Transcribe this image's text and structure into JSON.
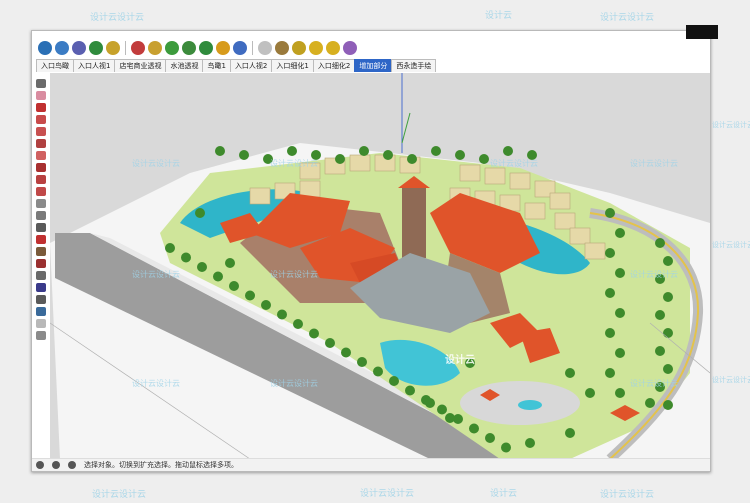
{
  "toolbar": {
    "icons": [
      {
        "name": "globe-icon",
        "color": "#2a6fb5"
      },
      {
        "name": "globe-icon",
        "color": "#3b7cc4"
      },
      {
        "name": "globe-icon",
        "color": "#5a5fb0"
      },
      {
        "name": "globe-icon",
        "color": "#2f8b3c"
      },
      {
        "name": "pencil-icon",
        "color": "#c7a22b"
      },
      {
        "name": "arrow-icon",
        "color": "#c23c3c"
      },
      {
        "name": "star-icon",
        "color": "#c8a030"
      },
      {
        "name": "plant-icon",
        "color": "#3c9b3c"
      },
      {
        "name": "plant-icon",
        "color": "#3c8b3c"
      },
      {
        "name": "globe-icon",
        "color": "#2f8b3c"
      },
      {
        "name": "circle-icon",
        "color": "#d79b1c"
      },
      {
        "name": "circle-icon",
        "color": "#3f6bc0"
      },
      {
        "name": "circle-icon",
        "color": "#c0c0c0"
      },
      {
        "name": "hammer-icon",
        "color": "#9a7a3c"
      },
      {
        "name": "wand-icon",
        "color": "#c0a020"
      },
      {
        "name": "circle-icon",
        "color": "#d7b020"
      },
      {
        "name": "circle-icon",
        "color": "#d7b020"
      },
      {
        "name": "cube-icon",
        "color": "#8f5fb8"
      }
    ]
  },
  "tabs": [
    {
      "label": "入口鸟瞰"
    },
    {
      "label": "入口人视1"
    },
    {
      "label": "店宅商业透视"
    },
    {
      "label": "水池透视"
    },
    {
      "label": "鸟瞰1"
    },
    {
      "label": "入口人视2"
    },
    {
      "label": "入口细化1"
    },
    {
      "label": "入口细化2"
    },
    {
      "label": "增加部分"
    },
    {
      "label": "西永造手绘"
    }
  ],
  "active_tab": 8,
  "status": {
    "text": "选择对象。切换到扩充选择。拖动鼠标选择多项。"
  },
  "watermarks": {
    "top": [
      "设计云设计云",
      "设计云",
      "设计云设计云"
    ],
    "right": [
      "设计云设计云"
    ],
    "bottom": [
      "设计云设计云",
      "设计云设计云",
      "设计云",
      "设计云设计云"
    ],
    "center": "设计云"
  },
  "colors": {
    "roof": "#e0542a",
    "water": "#2fb5c9",
    "grass": "#cfe59a",
    "road": "#9b9b9b",
    "tree": "#3e8a2c"
  }
}
